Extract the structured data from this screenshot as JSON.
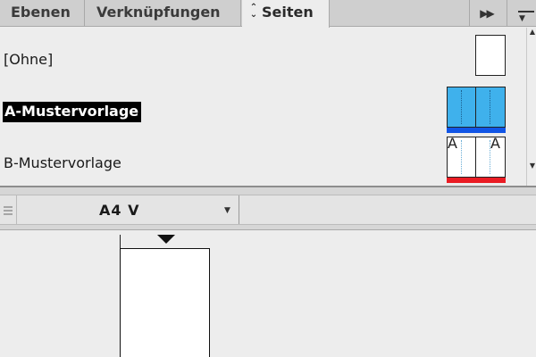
{
  "tabs": [
    {
      "label": "Ebenen"
    },
    {
      "label": "Verknüpfungen"
    },
    {
      "label": "Seiten",
      "active": true
    }
  ],
  "icons": {
    "tab_reorder": "up-down-arrows-icon",
    "collapse": "double-chevron-right-icon",
    "panel_menu": "panel-menu-icon",
    "grip": "grip-icon",
    "dropdown": "chevron-down-icon",
    "page_marker": "triangle-down-icon"
  },
  "masters": [
    {
      "label": "[Ohne]",
      "thumbnail": "single"
    },
    {
      "label": "A-Mustervorlage",
      "thumbnail": "spread",
      "selected": true,
      "fill_color": "#3fb1ec",
      "bar_color": "#1155e6"
    },
    {
      "label": "B-Mustervorlage",
      "thumbnail": "spread",
      "page_letters": [
        "A",
        "A"
      ],
      "bar_color": "#ea1c24"
    }
  ],
  "size_selector": {
    "value": "A4 V"
  },
  "pages_count_visible": 1
}
